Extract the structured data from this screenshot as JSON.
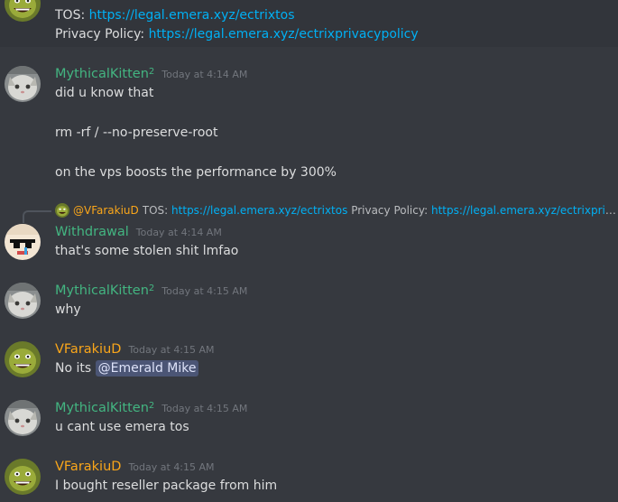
{
  "messages": {
    "top": {
      "tos_label": "TOS:",
      "tos_link": "https://legal.emera.xyz/ectrixtos",
      "privacy_label": "Privacy Policy:",
      "privacy_link": "https://legal.emera.xyz/ectrixprivacypolicy"
    },
    "m1": {
      "user": "MythicalKitten",
      "user_sup": "2",
      "time": "Today at 4:14 AM",
      "lines": [
        "did u know that",
        "rm -rf / --no-preserve-root",
        "on the vps boosts the performance by 300%"
      ]
    },
    "m2": {
      "reply_user": "@VFarakiuD",
      "reply_tos_label": "TOS:",
      "reply_tos_link": "https://legal.emera.xyz/ectrixtos",
      "reply_privacy_label": "Privacy Policy:",
      "reply_privacy_link": "https://legal.emera.xyz/ectrixpriv...",
      "user": "Withdrawal",
      "time": "Today at 4:14 AM",
      "text": "that's some stolen shit lmfao"
    },
    "m3": {
      "user": "MythicalKitten",
      "user_sup": "2",
      "time": "Today at 4:15 AM",
      "text": "why"
    },
    "m4": {
      "user": "VFarakiuD",
      "time": "Today at 4:15 AM",
      "text_prefix": "No its",
      "mention": "@Emerald Mike"
    },
    "m5": {
      "user": "MythicalKitten",
      "user_sup": "2",
      "time": "Today at 4:15 AM",
      "text": "u cant use emera tos"
    },
    "m6": {
      "user": "VFarakiuD",
      "time": "Today at 4:15 AM",
      "text": "I bought reseller package from him"
    }
  },
  "colors": {
    "background": "#36393f",
    "link": "#00b0f4",
    "username_green": "#43b581",
    "username_gold": "#faa61a",
    "timestamp": "#72767d",
    "mention_bg": "rgba(114,137,218,0.35)"
  }
}
